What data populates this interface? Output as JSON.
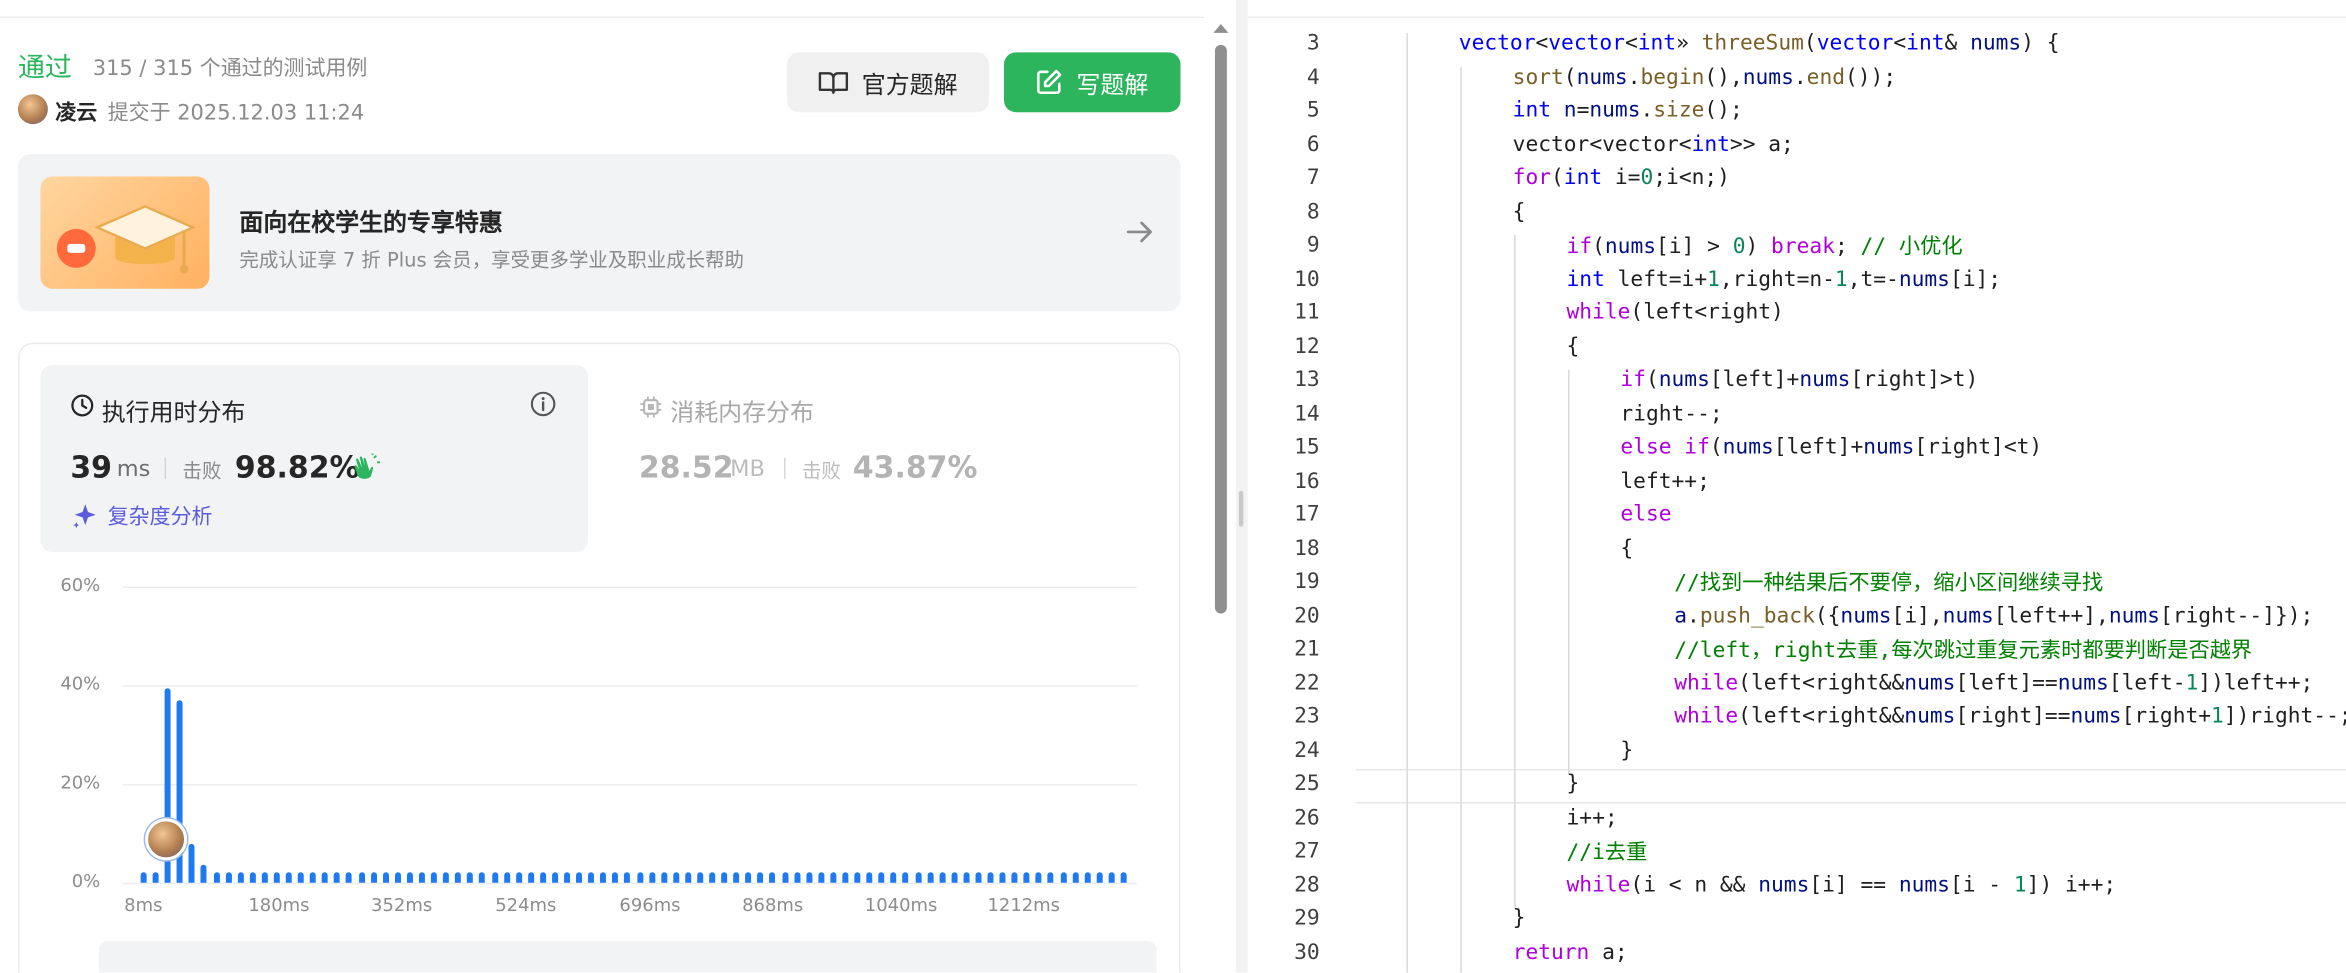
{
  "result": {
    "status": "通过",
    "passed_text": "315 / 315 个通过的测试用例",
    "user": "凌云",
    "submitted": "提交于 2025.12.03 11:24",
    "official_btn": "官方题解",
    "write_btn": "写题解"
  },
  "promo": {
    "title": "面向在校学生的专享特惠",
    "subtitle": "完成认证享 7 折 Plus 会员，享受更多学业及职业成长帮助"
  },
  "runtime": {
    "title": "执行用时分布",
    "value": "39",
    "unit": "ms",
    "beat_label": "击败",
    "beat": "98.82%",
    "complexity": "复杂度分析"
  },
  "memory": {
    "title": "消耗内存分布",
    "value": "28.52",
    "unit": "MB",
    "beat_label": "击败",
    "beat": "43.87%"
  },
  "chart_data": {
    "type": "bar",
    "ylabel_ticks": [
      "60%",
      "40%",
      "20%",
      "0%"
    ],
    "ylim": [
      0,
      60
    ],
    "x_ticks": [
      "8ms",
      "180ms",
      "352ms",
      "524ms",
      "696ms",
      "868ms",
      "1040ms",
      "1212ms"
    ],
    "bins_ms_step": 14.3,
    "values": [
      2,
      2,
      39.5,
      37,
      8,
      3.5,
      2,
      2,
      2,
      2,
      2,
      2,
      2,
      2,
      2,
      2,
      2,
      2,
      2,
      2,
      2,
      2,
      2,
      2,
      2,
      2,
      2,
      2,
      2,
      2,
      2,
      2,
      2,
      2,
      2,
      2,
      2,
      2,
      2,
      2,
      2,
      2,
      2,
      2,
      2,
      2,
      2,
      2,
      2,
      2,
      2,
      2,
      2,
      2,
      2,
      2,
      2,
      2,
      2,
      2,
      2,
      2,
      2,
      2,
      2,
      2,
      2,
      2,
      2,
      2,
      2,
      2,
      2,
      2,
      2,
      2,
      2,
      2,
      2,
      2,
      2,
      2
    ],
    "grid": true,
    "user_marker_bin": 2,
    "colors": {
      "bar": "#1f7af2"
    }
  },
  "code": [
    {
      "n": "3",
      "indent": 1,
      "segs": [
        [
          "ty",
          "vector"
        ],
        [
          "",
          "<"
        ],
        [
          "ty",
          "vector"
        ],
        [
          "",
          "<"
        ],
        [
          "ty",
          "int"
        ],
        [
          "",
          "» "
        ],
        [
          "fn",
          "threeSum"
        ],
        [
          "",
          "("
        ],
        [
          "ty",
          "vector"
        ],
        [
          "",
          "<"
        ],
        [
          "ty",
          "int"
        ],
        [
          "",
          "& "
        ],
        [
          "vr",
          "nums"
        ],
        [
          "",
          ") {"
        ]
      ]
    },
    {
      "n": "4",
      "indent": 2,
      "segs": [
        [
          "fn",
          "sort"
        ],
        [
          "",
          "("
        ],
        [
          "vr",
          "nums"
        ],
        [
          "",
          "."
        ],
        [
          "fn",
          "begin"
        ],
        [
          "",
          "(),"
        ],
        [
          "vr",
          "nums"
        ],
        [
          "",
          "."
        ],
        [
          "fn",
          "end"
        ],
        [
          "",
          "());"
        ]
      ]
    },
    {
      "n": "5",
      "indent": 2,
      "segs": [
        [
          "ty",
          "int"
        ],
        [
          "",
          " "
        ],
        [
          "vr",
          "n"
        ],
        [
          "",
          "="
        ],
        [
          "vr",
          "nums"
        ],
        [
          "",
          "."
        ],
        [
          "fn",
          "size"
        ],
        [
          "",
          "();"
        ]
      ]
    },
    {
      "n": "6",
      "indent": 2,
      "segs": [
        [
          "",
          "vector<vector<"
        ],
        [
          "ty",
          "int"
        ],
        [
          "",
          ">> a;"
        ]
      ]
    },
    {
      "n": "7",
      "indent": 2,
      "segs": [
        [
          "kw",
          "for"
        ],
        [
          "",
          "("
        ],
        [
          "ty",
          "int"
        ],
        [
          "",
          " i="
        ],
        [
          "nm",
          "0"
        ],
        [
          "",
          ";i<n;)"
        ]
      ]
    },
    {
      "n": "8",
      "indent": 2,
      "segs": [
        [
          "",
          "{"
        ]
      ]
    },
    {
      "n": "9",
      "indent": 3,
      "segs": [
        [
          "kw",
          "if"
        ],
        [
          "",
          "("
        ],
        [
          "vr",
          "nums"
        ],
        [
          "",
          "[i] > "
        ],
        [
          "nm",
          "0"
        ],
        [
          "",
          ") "
        ],
        [
          "kw",
          "break"
        ],
        [
          "",
          "; "
        ],
        [
          "cm",
          "// 小优化"
        ]
      ]
    },
    {
      "n": "10",
      "indent": 3,
      "segs": [
        [
          "ty",
          "int"
        ],
        [
          "",
          " left=i+"
        ],
        [
          "nm",
          "1"
        ],
        [
          "",
          ",right=n-"
        ],
        [
          "nm",
          "1"
        ],
        [
          "",
          ",t=-"
        ],
        [
          "vr",
          "nums"
        ],
        [
          "",
          "[i];"
        ]
      ]
    },
    {
      "n": "11",
      "indent": 3,
      "segs": [
        [
          "kw",
          "while"
        ],
        [
          "",
          "(left<right)"
        ]
      ]
    },
    {
      "n": "12",
      "indent": 3,
      "segs": [
        [
          "",
          "{"
        ]
      ]
    },
    {
      "n": "13",
      "indent": 4,
      "segs": [
        [
          "kw",
          "if"
        ],
        [
          "",
          "("
        ],
        [
          "vr",
          "nums"
        ],
        [
          "",
          "[left]+"
        ],
        [
          "vr",
          "nums"
        ],
        [
          "",
          "[right]>t)"
        ]
      ]
    },
    {
      "n": "14",
      "indent": 4,
      "segs": [
        [
          "",
          "right--;"
        ]
      ]
    },
    {
      "n": "15",
      "indent": 4,
      "segs": [
        [
          "kw",
          "else if"
        ],
        [
          "",
          "("
        ],
        [
          "vr",
          "nums"
        ],
        [
          "",
          "[left]+"
        ],
        [
          "vr",
          "nums"
        ],
        [
          "",
          "[right]<t)"
        ]
      ]
    },
    {
      "n": "16",
      "indent": 4,
      "segs": [
        [
          "",
          "left++;"
        ]
      ]
    },
    {
      "n": "17",
      "indent": 4,
      "segs": [
        [
          "kw",
          "else"
        ]
      ]
    },
    {
      "n": "18",
      "indent": 4,
      "segs": [
        [
          "",
          "{"
        ]
      ]
    },
    {
      "n": "19",
      "indent": 5,
      "segs": [
        [
          "cm",
          "//找到一种结果后不要停，缩小区间继续寻找"
        ]
      ]
    },
    {
      "n": "20",
      "indent": 5,
      "segs": [
        [
          "vr",
          "a"
        ],
        [
          "",
          "."
        ],
        [
          "fn",
          "push_back"
        ],
        [
          "",
          "({"
        ],
        [
          "vr",
          "nums"
        ],
        [
          "",
          "[i],"
        ],
        [
          "vr",
          "nums"
        ],
        [
          "",
          "[left++],"
        ],
        [
          "vr",
          "nums"
        ],
        [
          "",
          "[right--]});"
        ]
      ]
    },
    {
      "n": "21",
      "indent": 5,
      "segs": [
        [
          "cm",
          "//left，right去重,每次跳过重复元素时都要判断是否越界"
        ]
      ]
    },
    {
      "n": "22",
      "indent": 5,
      "segs": [
        [
          "kw",
          "while"
        ],
        [
          "",
          "(left<right&&"
        ],
        [
          "vr",
          "nums"
        ],
        [
          "",
          "[left]=="
        ],
        [
          "vr",
          "nums"
        ],
        [
          "",
          "[left-"
        ],
        [
          "nm",
          "1"
        ],
        [
          "",
          "])left++;"
        ]
      ]
    },
    {
      "n": "23",
      "indent": 5,
      "segs": [
        [
          "kw",
          "while"
        ],
        [
          "",
          "(left<right&&"
        ],
        [
          "vr",
          "nums"
        ],
        [
          "",
          "[right]=="
        ],
        [
          "vr",
          "nums"
        ],
        [
          "",
          "[right+"
        ],
        [
          "nm",
          "1"
        ],
        [
          "",
          "])right--;"
        ]
      ]
    },
    {
      "n": "24",
      "indent": 4,
      "segs": [
        [
          "",
          "}"
        ]
      ]
    },
    {
      "n": "25",
      "indent": 3,
      "segs": [
        [
          "",
          "}"
        ]
      ]
    },
    {
      "n": "26",
      "indent": 3,
      "segs": [
        [
          "",
          "i++;"
        ]
      ]
    },
    {
      "n": "27",
      "indent": 3,
      "segs": [
        [
          "cm",
          "//i去重"
        ]
      ]
    },
    {
      "n": "28",
      "indent": 3,
      "segs": [
        [
          "kw",
          "while"
        ],
        [
          "",
          "(i < n && "
        ],
        [
          "vr",
          "nums"
        ],
        [
          "",
          "[i] == "
        ],
        [
          "vr",
          "nums"
        ],
        [
          "",
          "[i - "
        ],
        [
          "nm",
          "1"
        ],
        [
          "",
          "]) i++;"
        ]
      ]
    },
    {
      "n": "29",
      "indent": 2,
      "segs": [
        [
          "",
          "}"
        ]
      ]
    },
    {
      "n": "30",
      "indent": 2,
      "segs": [
        [
          "kw",
          "return"
        ],
        [
          "",
          " a;"
        ]
      ]
    }
  ]
}
